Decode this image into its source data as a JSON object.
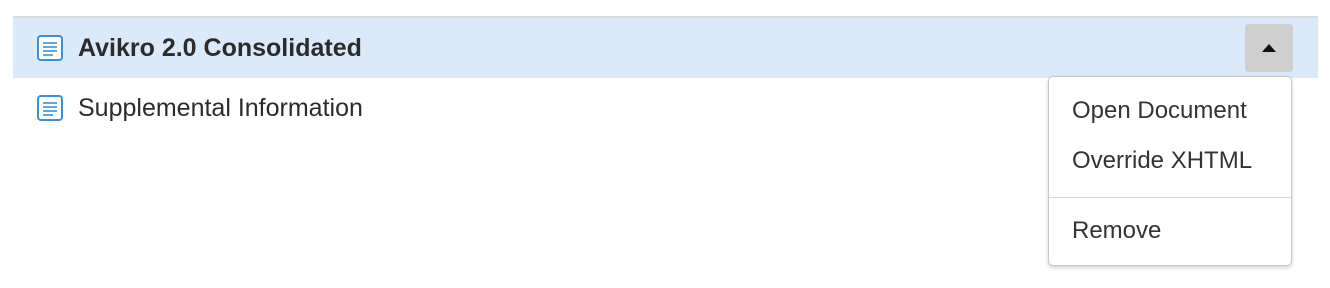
{
  "documents": [
    {
      "label": "Avikro 2.0 Consolidated",
      "icon": "document-icon",
      "selected": true
    },
    {
      "label": "Supplemental Information",
      "icon": "document-icon",
      "selected": false
    }
  ],
  "menu": {
    "toggle_icon": "caret-up-icon",
    "items": [
      {
        "label": "Open Document"
      },
      {
        "label": "Override XHTML"
      },
      {
        "label": "Remove"
      }
    ]
  },
  "colors": {
    "selected_row": "#dbeafb",
    "icon_accent": "#3b8fd9",
    "toggle_button": "#cfcfcf",
    "text": "#2b2b2b"
  }
}
